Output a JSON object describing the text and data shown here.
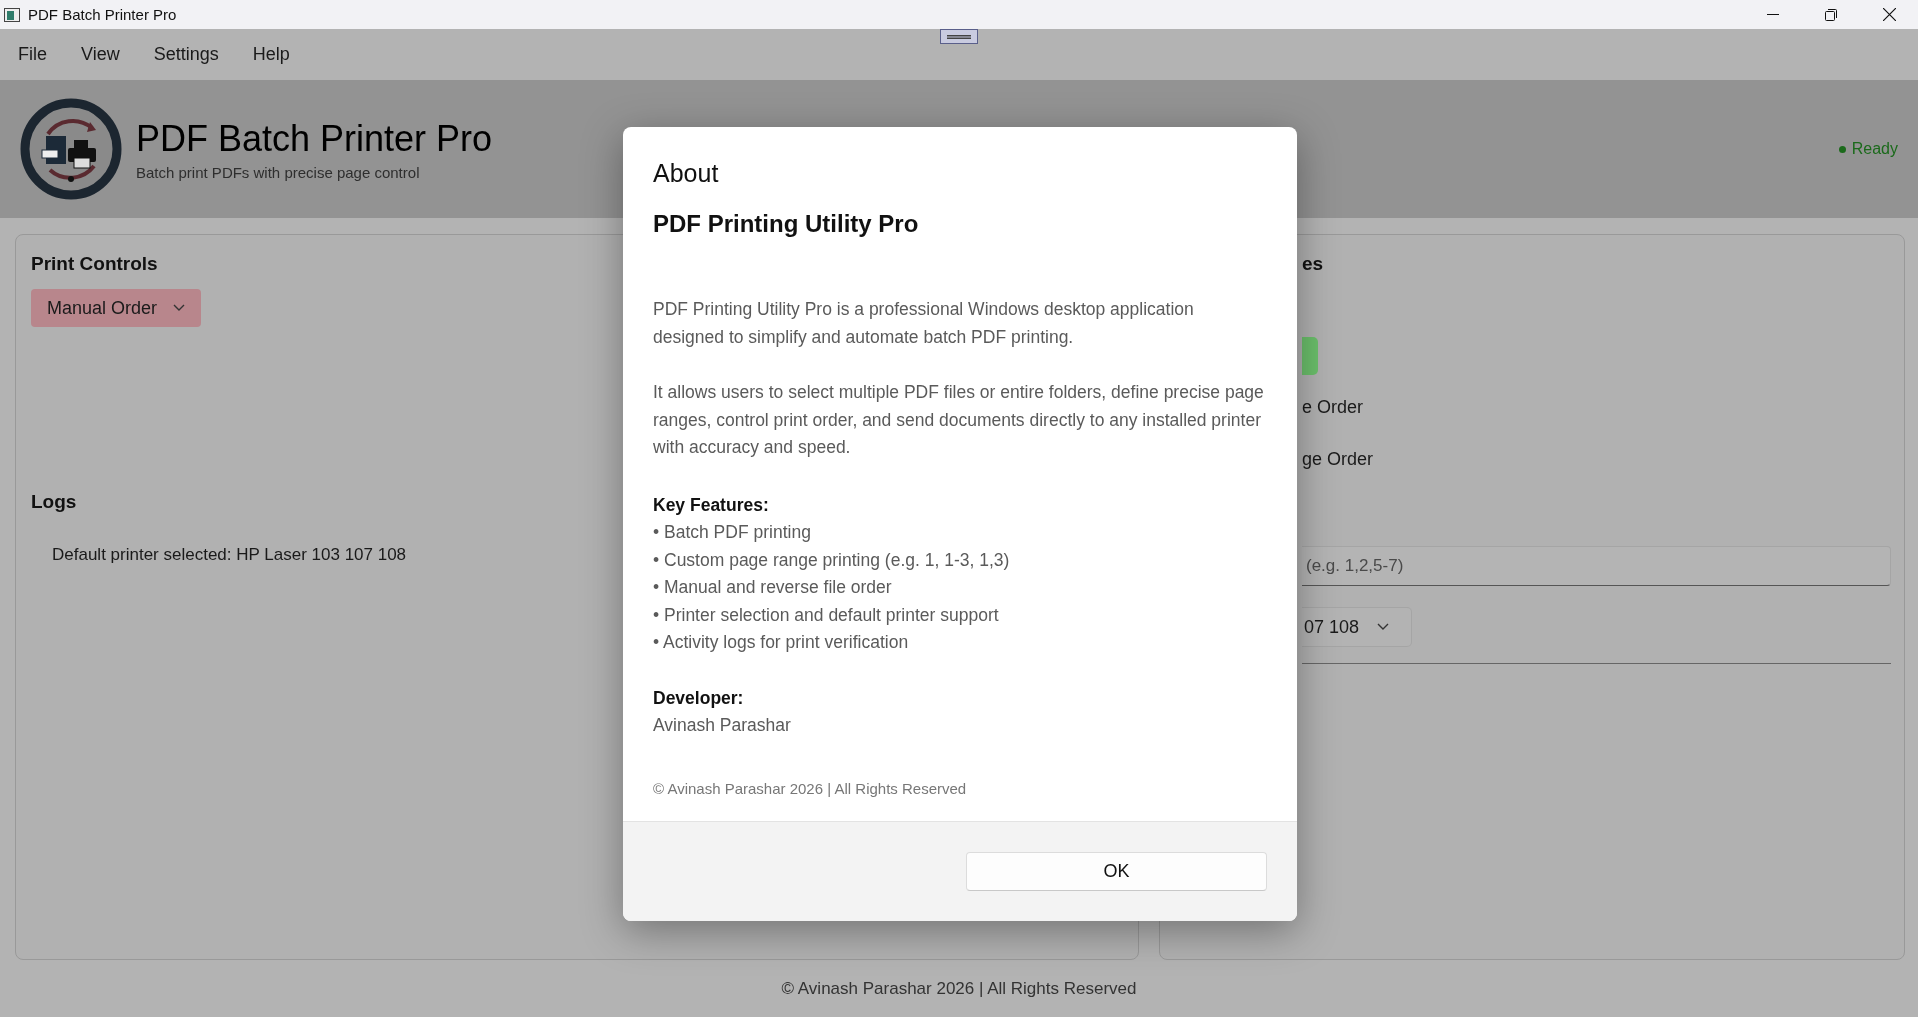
{
  "window": {
    "title": "PDF Batch Printer Pro"
  },
  "menu": [
    "File",
    "View",
    "Settings",
    "Help"
  ],
  "header": {
    "title": "PDF Batch Printer Pro",
    "subtitle": "Batch print PDFs with precise page control",
    "status": "Ready"
  },
  "print_controls": {
    "title": "Print Controls",
    "order_dropdown": "Manual Order"
  },
  "logs": {
    "title": "Logs",
    "entries": [
      "Default printer selected: HP Laser 103 107 108"
    ]
  },
  "right_panel": {
    "title": "es",
    "options": [
      "e Order",
      "ge Order"
    ],
    "page_field": {
      "placeholder": "(e.g. 1,2,5-7)"
    },
    "printer_dropdown": "07 108"
  },
  "footer": "© Avinash Parashar 2026 | All Rights Reserved",
  "dialog": {
    "title": "About",
    "heading": "PDF Printing Utility Pro",
    "paragraphs": [
      "PDF Printing Utility Pro is a professional Windows desktop application designed to simplify and automate batch PDF printing.",
      "It allows users to select multiple PDF files or entire folders, define precise page ranges, control print order, and send documents directly to any installed printer with accuracy and speed."
    ],
    "features_title": "Key Features:",
    "features": [
      "• Batch PDF printing",
      "• Custom page range printing (e.g. 1, 1-3, 1,3)",
      "• Manual and reverse file order",
      "• Printer selection and default printer support",
      "• Activity logs for print verification"
    ],
    "developer_title": "Developer:",
    "developer": "Avinash Parashar",
    "copyright": "© Avinash Parashar 2026 | All Rights Reserved",
    "button": "OK"
  }
}
